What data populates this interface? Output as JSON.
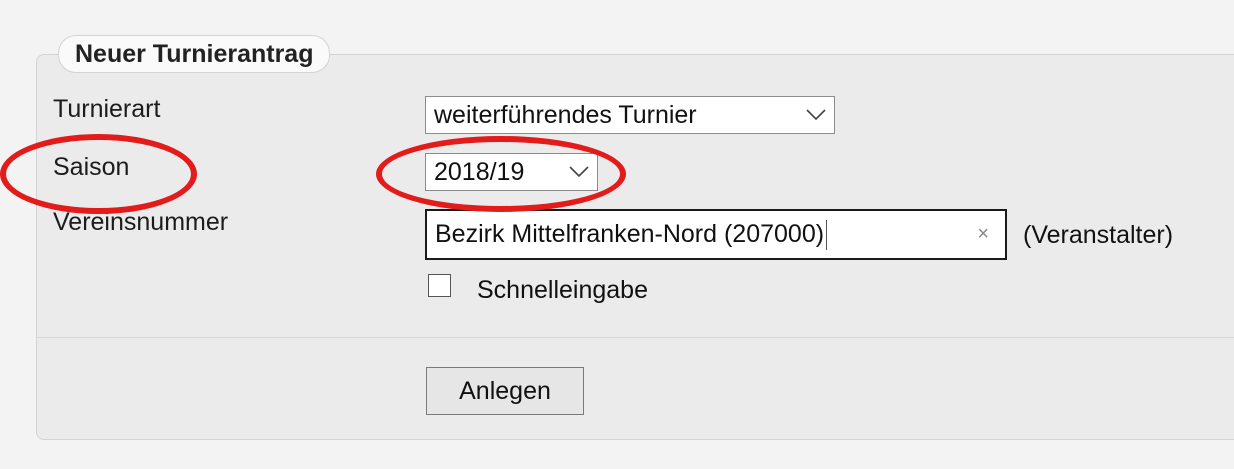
{
  "form": {
    "legend": "Neuer Turnierantrag",
    "turnierart": {
      "label": "Turnierart",
      "value": "weiterführendes Turnier"
    },
    "saison": {
      "label": "Saison",
      "value": "2018/19"
    },
    "vereinsnummer": {
      "label": "Vereinsnummer",
      "value": "Bezirk Mittelfranken-Nord (207000)",
      "clear_symbol": "×",
      "suffix": "(Veranstalter)"
    },
    "schnelleingabe": {
      "label": "Schnelleingabe",
      "checked": false
    },
    "submit_label": "Anlegen"
  },
  "annotations": {
    "color": "#e21b1b"
  },
  "icons": {
    "dropdown": "chevron-down-icon",
    "clear": "clear-icon",
    "checkbox": "checkbox-icon"
  }
}
